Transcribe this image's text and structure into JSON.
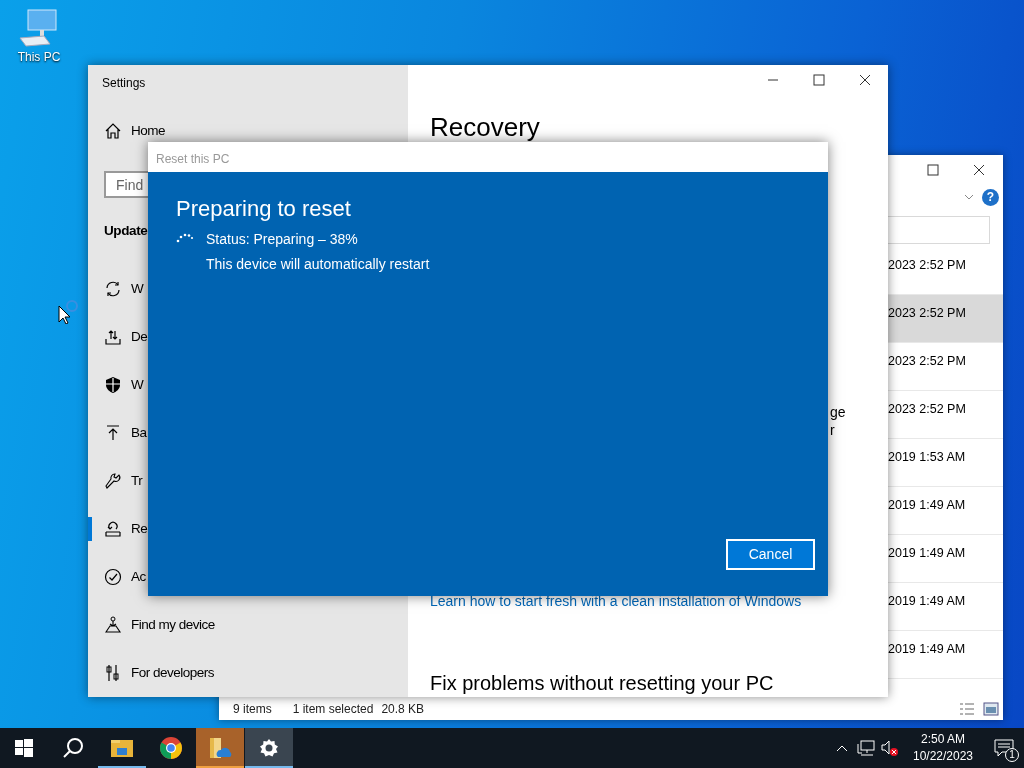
{
  "desktop_icons": [
    {
      "label": "This PC"
    }
  ],
  "explorer": {
    "help": "?",
    "rows": [
      {
        "modified": "2023 2:52 PM",
        "selected": false
      },
      {
        "modified": "2023 2:52 PM",
        "selected": true
      },
      {
        "modified": "2023 2:52 PM",
        "selected": false
      },
      {
        "modified": "2023 2:52 PM",
        "selected": false
      },
      {
        "modified": "2019 1:53 AM",
        "selected": false
      },
      {
        "modified": "2019 1:49 AM",
        "selected": false
      },
      {
        "modified": "2019 1:49 AM",
        "selected": false
      },
      {
        "modified": "2019 1:49 AM",
        "selected": false
      },
      {
        "modified": "2019 1:49 AM",
        "selected": false
      }
    ],
    "status": {
      "count": "9 items",
      "selection": "1 item selected",
      "size": "20.8 KB"
    }
  },
  "settings": {
    "title": "Settings",
    "home": "Home",
    "search": {
      "placeholder": "Find"
    },
    "section": "Update",
    "items": [
      {
        "label": "W",
        "kind": "sync",
        "selected": false
      },
      {
        "label": "De",
        "kind": "delivery",
        "selected": false
      },
      {
        "label": "W",
        "kind": "shield",
        "selected": false
      },
      {
        "label": "Ba",
        "kind": "backup",
        "selected": false
      },
      {
        "label": "Tr",
        "kind": "wrench",
        "selected": false
      },
      {
        "label": "Re",
        "kind": "recovery",
        "selected": true
      },
      {
        "label": "Ac",
        "kind": "check",
        "selected": false
      },
      {
        "label": "Find my device",
        "kind": "find",
        "selected": false
      },
      {
        "label": "For developers",
        "kind": "dev",
        "selected": false
      }
    ],
    "heading": "Recovery",
    "fragments": [
      "ge",
      "r"
    ],
    "link": "Learn how to start fresh with a clean installation of Windows",
    "subheading": "Fix problems without resetting your PC"
  },
  "dialog": {
    "title": "Reset this PC",
    "heading": "Preparing to reset",
    "status": "Status: Preparing – 38%",
    "note": "This device will automatically restart",
    "button": "Cancel"
  },
  "taskbar": {
    "apps": [
      {
        "kind": "start",
        "open": false,
        "attention": false,
        "focused": false
      },
      {
        "kind": "search",
        "open": false,
        "attention": false,
        "focused": false
      },
      {
        "kind": "explorer",
        "open": true,
        "attention": false,
        "focused": false
      },
      {
        "kind": "browser",
        "open": false,
        "attention": false,
        "focused": false
      },
      {
        "kind": "folder-cloud",
        "open": false,
        "attention": true,
        "focused": false
      },
      {
        "kind": "settings",
        "open": true,
        "attention": false,
        "focused": true
      }
    ],
    "time": "2:50 AM",
    "date": "10/22/2023",
    "notifications": "1"
  }
}
